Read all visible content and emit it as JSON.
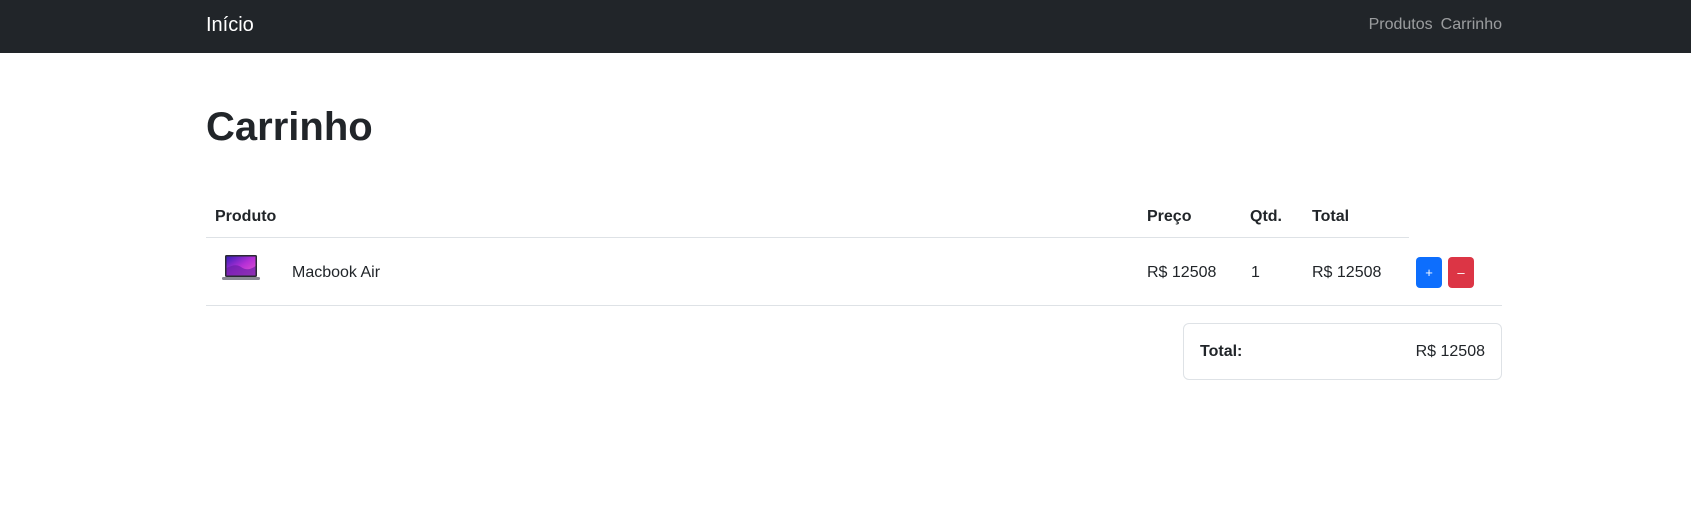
{
  "navbar": {
    "brand": "Início",
    "links": [
      "Produtos",
      "Carrinho"
    ]
  },
  "page": {
    "title": "Carrinho"
  },
  "table": {
    "headers": {
      "product": "Produto",
      "price": "Preço",
      "qty": "Qtd.",
      "total": "Total"
    },
    "rows": [
      {
        "name": "Macbook Air",
        "image": "laptop-thumbnail",
        "price": "R$ 12508",
        "qty": "1",
        "total": "R$ 12508",
        "plus_label": "+",
        "minus_label": "–"
      }
    ]
  },
  "summary": {
    "label": "Total:",
    "value": "R$ 12508"
  },
  "colors": {
    "navbar_bg": "#212529",
    "primary": "#0d6efd",
    "danger": "#dc3545"
  }
}
